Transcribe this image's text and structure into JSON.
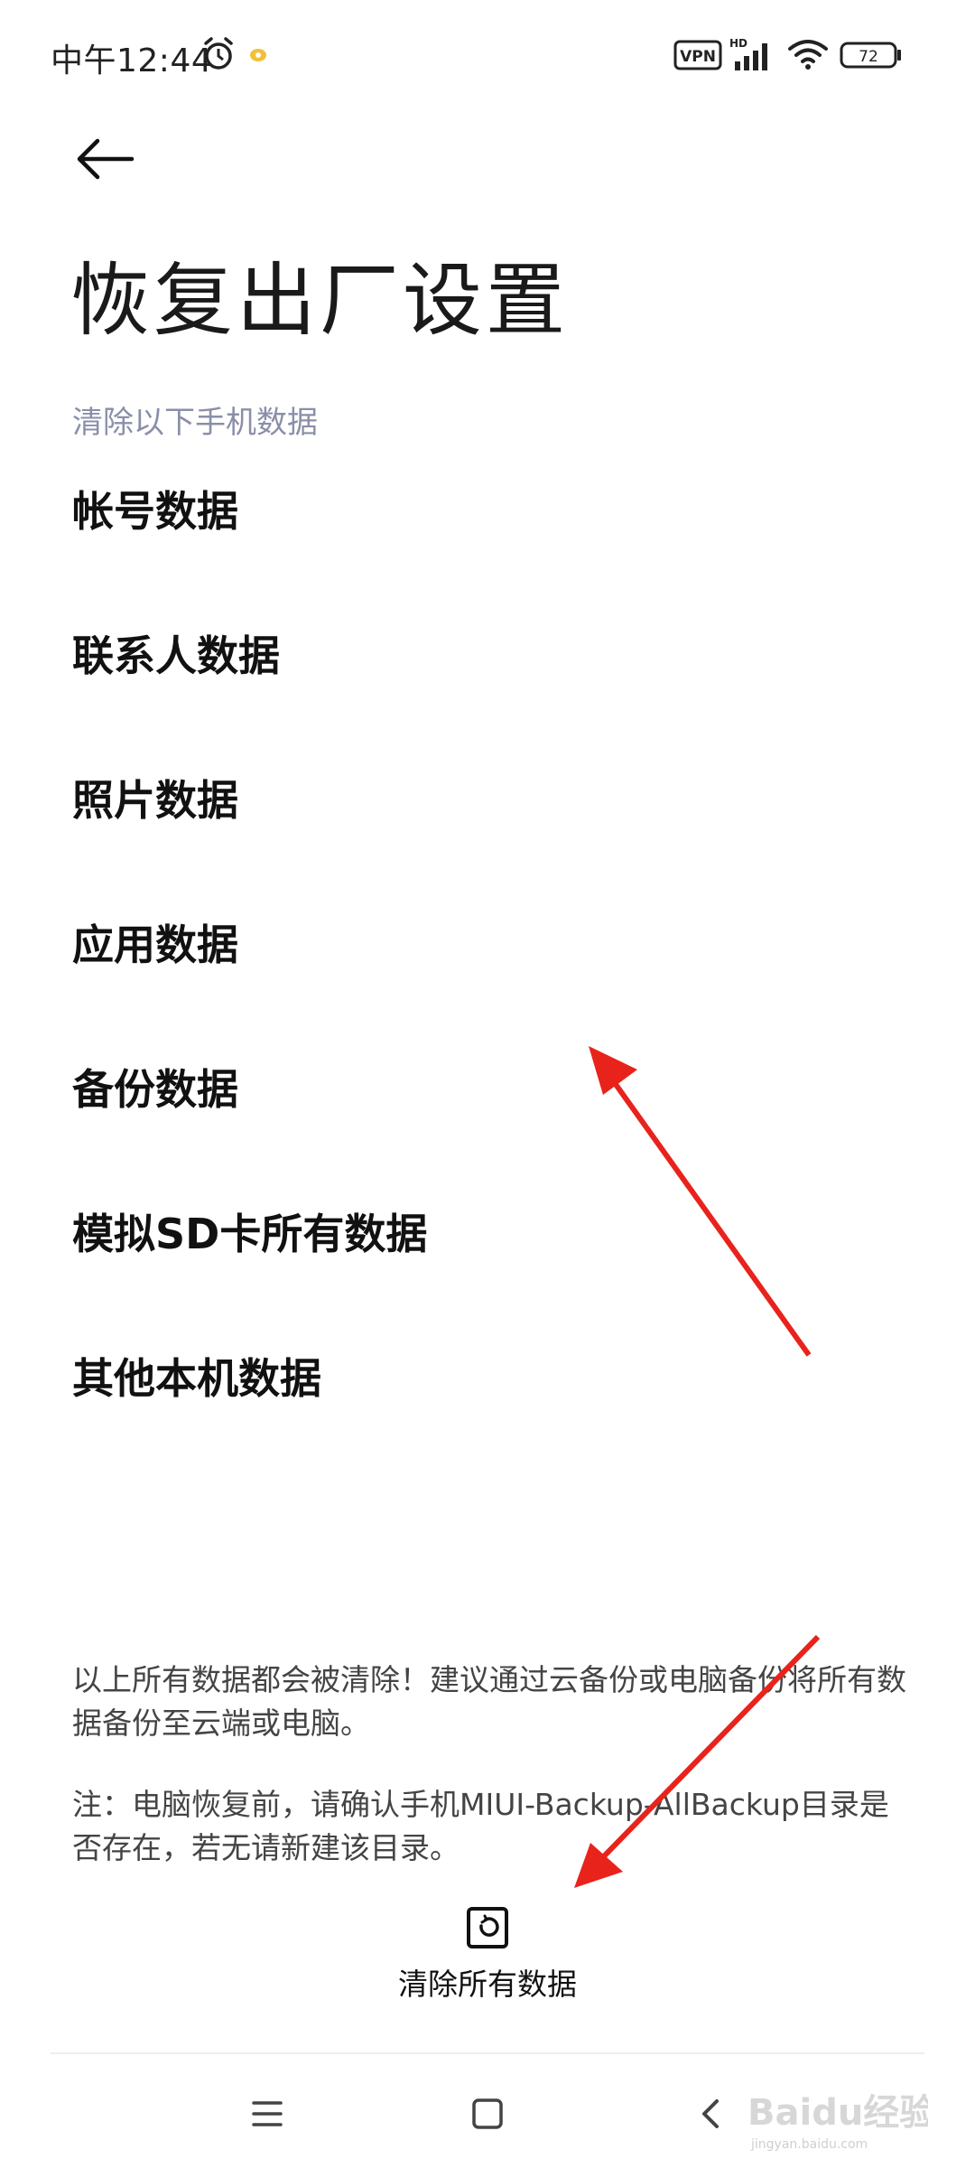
{
  "status_bar": {
    "time": "中午12:44",
    "vpn_label": "VPN",
    "hd_label": "HD",
    "battery_level": "72",
    "icons": [
      "alarm-icon",
      "notification-dot-icon",
      "vpn-icon",
      "signal-icon",
      "wifi-icon",
      "battery-icon"
    ]
  },
  "header": {
    "back_icon": "back-arrow-icon",
    "title": "恢复出厂设置"
  },
  "section": {
    "label": "清除以下手机数据",
    "items": [
      {
        "label": "帐号数据"
      },
      {
        "label": "联系人数据"
      },
      {
        "label": "照片数据"
      },
      {
        "label": "应用数据"
      },
      {
        "label": "备份数据"
      },
      {
        "label": "模拟SD卡所有数据"
      },
      {
        "label": "其他本机数据"
      }
    ]
  },
  "notice": {
    "warning": "以上所有数据都会被清除！建议通过云备份或电脑备份将所有数据备份至云端或电脑。",
    "note": "注：电脑恢复前，请确认手机MIUI-Backup-AllBackup目录是否存在，若无请新建该目录。"
  },
  "action": {
    "icon": "reset-icon",
    "label": "清除所有数据"
  },
  "nav_bar": {
    "icons": [
      "menu-icon",
      "home-icon",
      "back-icon"
    ]
  },
  "watermark": {
    "brand": "Baidu经验",
    "url": "jingyan.baidu.com"
  },
  "colors": {
    "section_label": "#8a8fa8",
    "annotation_arrow": "#e8231c"
  }
}
